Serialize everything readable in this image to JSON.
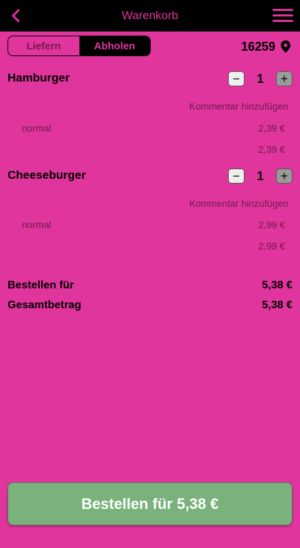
{
  "header": {
    "title": "Warenkorb"
  },
  "delivery": {
    "tabs": [
      "Liefern",
      "Abholen"
    ],
    "selected": "Abholen",
    "zip": "16259"
  },
  "cart": {
    "items": [
      {
        "name": "Hamburger",
        "quantity": "1",
        "comment": "Kommentar hinzufügen",
        "variant": "normal",
        "variant_price": "2,39 €",
        "line_total": "2,39 €"
      },
      {
        "name": "Cheeseburger",
        "quantity": "1",
        "comment": "Kommentar hinzufügen",
        "variant": "normal",
        "variant_price": "2,99 €",
        "line_total": "2,99 €"
      }
    ]
  },
  "summary": {
    "order_for_label": "Bestellen für",
    "order_for_value": "5,38 €",
    "total_label": "Gesamtbetrag",
    "total_value": "5,38 €"
  },
  "order_button": {
    "label": "Bestellen für 5,38 €"
  },
  "colors": {
    "background": "#e0359c",
    "topbar": "#000000",
    "accent": "#e0359c",
    "order_button": "#79b27a"
  }
}
